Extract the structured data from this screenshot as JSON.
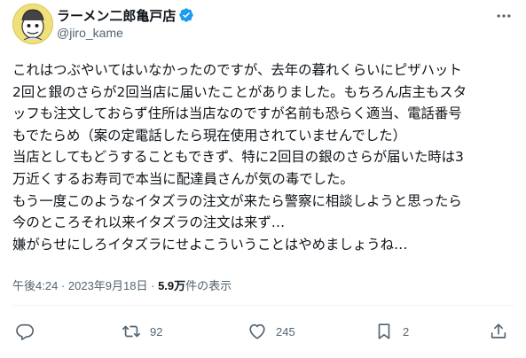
{
  "author": {
    "display_name": "ラーメン二郎亀戸店",
    "handle": "@jiro_kame",
    "verified": true
  },
  "tweet": {
    "text": "これはつぶやいてはいなかったのですが、去年の暮れくらいにピザハット\n2回と銀のさらが2回当店に届いたことがありました。もちろん店主もスタ\nッフも注文しておらず住所は当店なのですが名前も恐らく適当、電話番号\nもでたらめ（案の定電話したら現在使用されていませんでした）\n当店としてもどうすることもできず、特に2回目の銀のさらが届いた時は3\n万近くするお寿司で本当に配達員さんが気の毒でした。\nもう一度このようなイタズラの注文が来たら警察に相談しようと思ったら\n今のところそれ以来イタズラの注文は来ず…\n嫌がらせにしろイタズラにせよこういうことはやめましょうね…"
  },
  "meta": {
    "time": "午後4:24",
    "separator": " · ",
    "date": "2023年9月18日",
    "views_count": "5.9万",
    "views_label": "件の表示"
  },
  "actions": {
    "reply_icon": "reply-icon",
    "retweet_icon": "retweet-icon",
    "retweet_count": "92",
    "like_icon": "heart-icon",
    "like_count": "245",
    "bookmark_icon": "bookmark-icon",
    "bookmark_count": "2",
    "share_icon": "share-icon"
  },
  "colors": {
    "verified_blue": "#1d9bf0",
    "secondary_text": "#536471",
    "primary_text": "#0f1419",
    "avatar_yellow": "#e8d873"
  }
}
